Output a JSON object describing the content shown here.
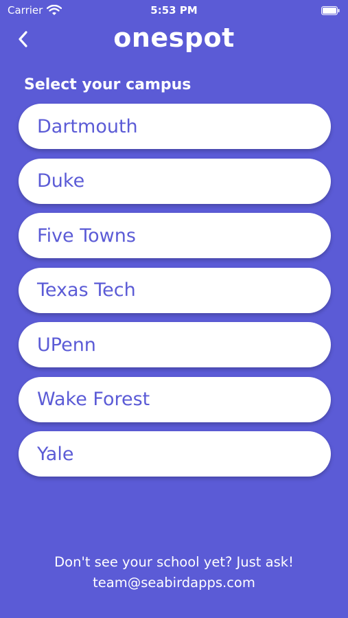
{
  "status_bar": {
    "carrier": "Carrier",
    "time": "5:53 PM"
  },
  "header": {
    "logo_text": "onespot",
    "back_icon": "chevron-left-icon"
  },
  "section_label": "Select your campus",
  "campuses": [
    {
      "label": "Dartmouth"
    },
    {
      "label": "Duke"
    },
    {
      "label": "Five Towns"
    },
    {
      "label": "Texas Tech"
    },
    {
      "label": "UPenn"
    },
    {
      "label": "Wake Forest"
    },
    {
      "label": "Yale"
    }
  ],
  "footer": {
    "line1": "Don't see your school yet? Just ask!",
    "email": "team@seabirdapps.com"
  },
  "colors": {
    "background": "#5b5bd6",
    "button_bg": "#ffffff",
    "button_text": "#5b5bd6"
  }
}
